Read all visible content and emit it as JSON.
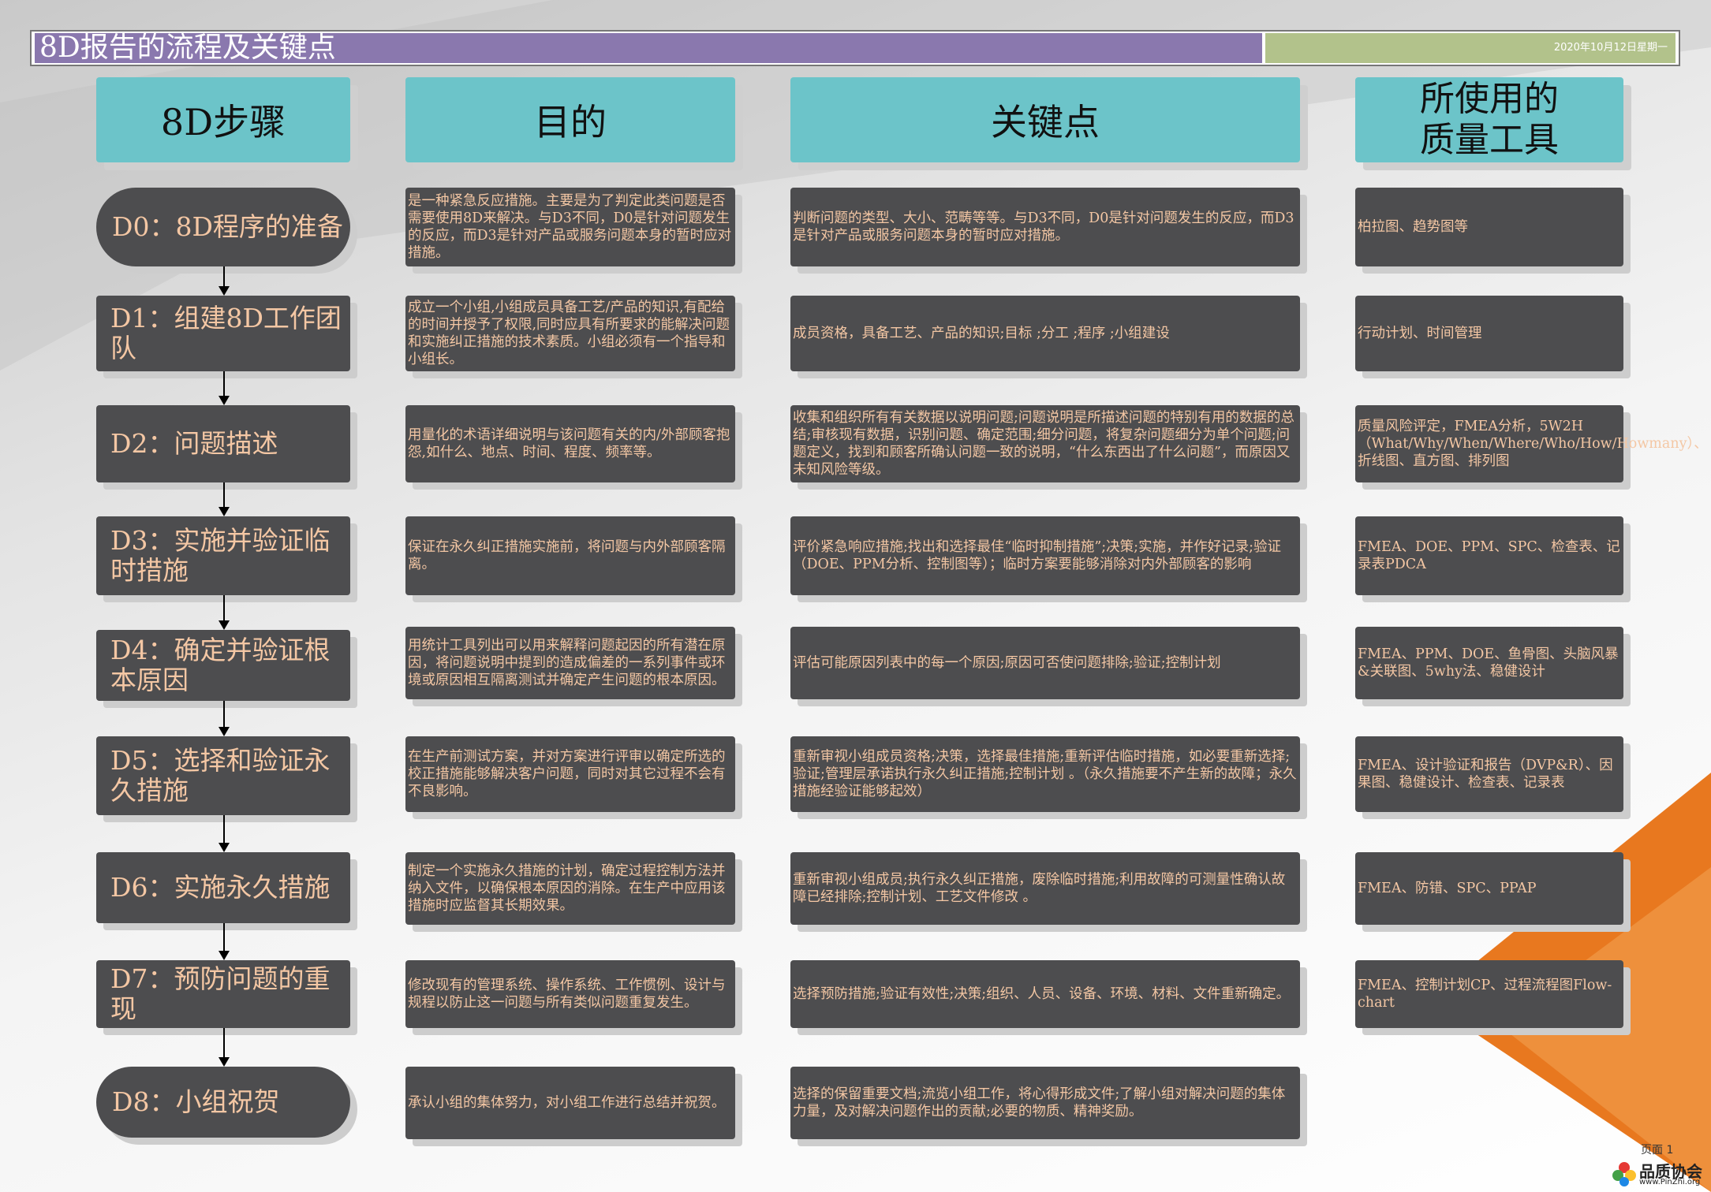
{
  "title": "8D报告的流程及关键点",
  "date": "2020年10月12日星期一",
  "headers": {
    "steps": "8D步骤",
    "purpose": "目的",
    "keypoints": "关键点",
    "tools_line1": "所使用的",
    "tools_line2": "质量工具"
  },
  "rows": [
    {
      "step": "D0：8D程序的准备",
      "purpose": "是一种紧急反应措施。主要是为了判定此类问题是否需要使用8D来解决。与D3不同，D0是针对问题发生的反应，而D3是针对产品或服务问题本身的暂时应对措施。",
      "keypoints": "判断问题的类型、大小、范畴等等。与D3不同，D0是针对问题发生的反应，而D3是针对产品或服务问题本身的暂时应对措施。",
      "tools": "柏拉图、趋势图等"
    },
    {
      "step": "D1：组建8D工作团队",
      "purpose": "成立一个小组,小组成员具备工艺/产品的知识,有配给的时间并授予了权限,同时应具有所要求的能解决问题和实施纠正措施的技术素质。小组必须有一个指导和小组长。",
      "keypoints": "成员资格，具备工艺、产品的知识;目标 ;分工 ;程序 ;小组建设",
      "tools": "行动计划、时间管理"
    },
    {
      "step": "D2：问题描述",
      "purpose": "用量化的术语详细说明与该问题有关的内/外部顾客抱怨,如什么、地点、时间、程度、频率等。",
      "keypoints": "收集和组织所有有关数据以说明问题;问题说明是所描述问题的特别有用的数据的总结;审核现有数据，识别问题、确定范围;细分问题，将复杂问题细分为单个问题;问题定义，找到和顾客所确认问题一致的说明，“什么东西出了什么问题”，而原因又未知风险等级。",
      "tools": "质量风险评定，FMEA分析，5W2H（What/Why/When/Where/Who/How/Howmany）、折线图、直方图、排列图"
    },
    {
      "step": "D3：实施并验证临时措施",
      "purpose": "保证在永久纠正措施实施前，将问题与内外部顾客隔离。",
      "keypoints": "评价紧急响应措施;找出和选择最佳“临时抑制措施”;决策;实施，并作好记录;验证（DOE、PPM分析、控制图等）；临时方案要能够消除对内外部顾客的影响",
      "tools": "FMEA、DOE、PPM、SPC、检查表、记录表PDCA"
    },
    {
      "step": "D4：确定并验证根本原因",
      "purpose": "用统计工具列出可以用来解释问题起因的所有潜在原因，将问题说明中提到的造成偏差的一系列事件或环境或原因相互隔离测试并确定产生问题的根本原因。",
      "keypoints": "评估可能原因列表中的每一个原因;原因可否使问题排除;验证;控制计划",
      "tools": "FMEA、PPM、DOE、鱼骨图、头脑风暴&关联图、5why法、稳健设计"
    },
    {
      "step": "D5：选择和验证永久措施",
      "purpose": "在生产前测试方案，并对方案进行评审以确定所选的校正措施能够解决客户问题，同时对其它过程不会有不良影响。",
      "keypoints": "重新审视小组成员资格;决策，选择最佳措施;重新评估临时措施，如必要重新选择;验证;管理层承诺执行永久纠正措施;控制计划 。（永久措施要不产生新的故障；永久措施经验证能够起效）",
      "tools": "FMEA、设计验证和报告（DVP&R）、因果图、稳健设计、检查表、记录表"
    },
    {
      "step": "D6：实施永久措施",
      "purpose": "制定一个实施永久措施的计划，确定过程控制方法并纳入文件，以确保根本原因的消除。在生产中应用该措施时应监督其长期效果。",
      "keypoints": "重新审视小组成员;执行永久纠正措施，废除临时措施;利用故障的可测量性确认故障已经排除;控制计划、工艺文件修改 。",
      "tools": "FMEA、防错、SPC、PPAP"
    },
    {
      "step": "D7：预防问题的重现",
      "purpose": "修改现有的管理系统、操作系统、工作惯例、设计与规程以防止这一问题与所有类似问题重复发生。",
      "keypoints": "选择预防措施;验证有效性;决策;组织、人员、设备、环境、材料、文件重新确定。",
      "tools": "FMEA、控制计划CP、过程流程图Flow-chart"
    },
    {
      "step": "D8：小组祝贺",
      "purpose": "承认小组的集体努力，对小组工作进行总结并祝贺。",
      "keypoints": "选择的保留重要文档;流览小组工作，将心得形成文件;了解小组对解决问题的集体力量，及对解决问题作出的贡献;必要的物质、精神奖励。",
      "tools": ""
    }
  ],
  "footer": {
    "page": "页面 1",
    "logo_text": "品质协会",
    "logo_url": "www.PinZhi.org"
  }
}
